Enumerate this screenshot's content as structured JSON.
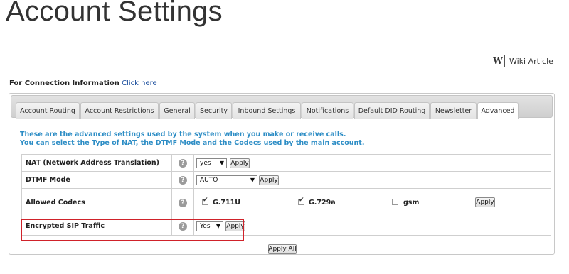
{
  "page": {
    "title": "Account Settings"
  },
  "wiki": {
    "icon_letter": "W",
    "label": "Wiki Article"
  },
  "connection": {
    "label": "For Connection Information",
    "link": "Click here"
  },
  "tabs": [
    {
      "label": "Account Routing"
    },
    {
      "label": "Account Restrictions"
    },
    {
      "label": "General"
    },
    {
      "label": "Security"
    },
    {
      "label": "Inbound Settings"
    },
    {
      "label": "Notifications"
    },
    {
      "label": "Default DID Routing"
    },
    {
      "label": "Newsletter"
    },
    {
      "label": "Advanced",
      "active": true
    }
  ],
  "description": {
    "line1": "These are the advanced settings used by the system when you make or receive calls.",
    "line2": "You can select the Type of NAT, the DTMF Mode and the Codecs used by the main account."
  },
  "settings": {
    "help_glyph": "?",
    "nat": {
      "label": "NAT (Network Address Translation)",
      "value": "yes",
      "apply": "Apply"
    },
    "dtmf": {
      "label": "DTMF Mode",
      "value": "AUTO",
      "apply": "Apply"
    },
    "codecs": {
      "label": "Allowed Codecs",
      "items": [
        {
          "name": "G.711U",
          "checked": true
        },
        {
          "name": "G.729a",
          "checked": true
        },
        {
          "name": "gsm",
          "checked": false
        }
      ],
      "apply": "Apply"
    },
    "encrypted": {
      "label": "Encrypted SIP Traffic",
      "value": "Yes",
      "apply": "Apply"
    }
  },
  "apply_all": "Apply All",
  "colors": {
    "description": "#2d8dc5",
    "highlight": "#d0222a",
    "link": "#1a4d9c"
  }
}
